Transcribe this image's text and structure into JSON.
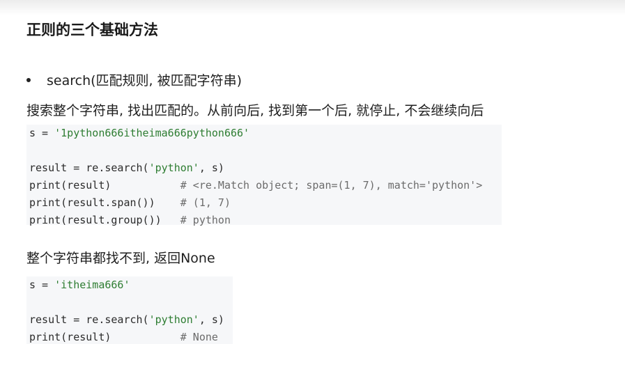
{
  "title": "正则的三个基础方法",
  "bullet": {
    "text": "search(匹配规则, 被匹配字符串)"
  },
  "section1": {
    "description": "搜索整个字符串, 找出匹配的。从前向后, 找到第一个后, 就停止, 不会继续向后",
    "code": {
      "line1_prefix": "s = ",
      "line1_string": "'1python666itheima666python666'",
      "line3_prefix": "result = re.search(",
      "line3_string": "'python'",
      "line3_suffix": ", s)",
      "line4_code": "print(result)           ",
      "line4_comment": "# <re.Match object; span=(1, 7), match='python'>",
      "line5_code": "print(result.span())    ",
      "line5_comment": "# (1, 7)",
      "line6_code": "print(result.group())   ",
      "line6_comment": "# python"
    }
  },
  "section2": {
    "description": "整个字符串都找不到, 返回None",
    "code": {
      "line1_prefix": "s = ",
      "line1_string": "'itheima666'",
      "line3_prefix": "result = re.search(",
      "line3_string": "'python'",
      "line3_suffix": ", s)",
      "line4_code": "print(result)           ",
      "line4_comment": "# None"
    }
  },
  "colors": {
    "string": "#2e7d32",
    "comment": "#6b6b6b",
    "code_background": "#f6f7f9"
  }
}
